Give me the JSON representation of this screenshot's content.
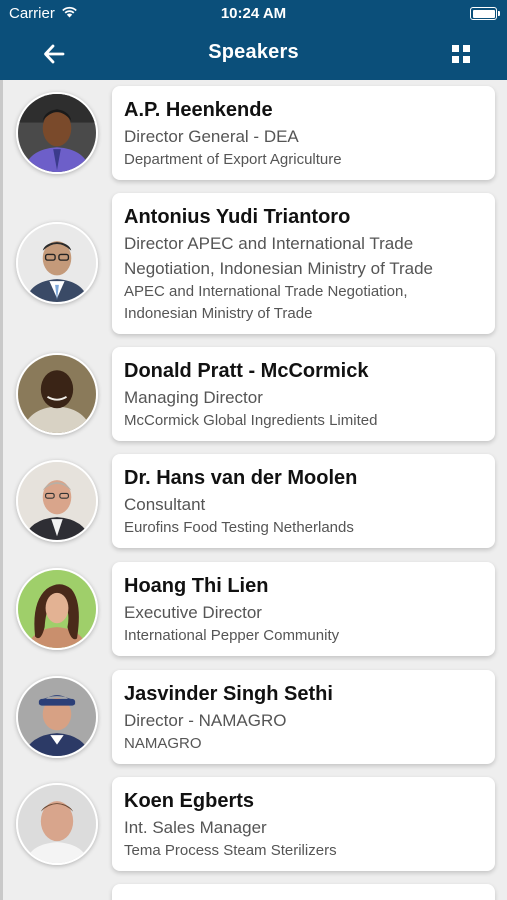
{
  "status_bar": {
    "carrier": "Carrier",
    "time": "10:24 AM"
  },
  "nav": {
    "title": "Speakers",
    "back_icon": "arrow-left-icon",
    "grid_icon": "grid-icon"
  },
  "colors": {
    "header": "#0b4f7a",
    "background": "#eeeeee",
    "card": "#ffffff"
  },
  "speakers": [
    {
      "name": "A.P. Heenkende",
      "title": "Director General - DEA",
      "org": "Department of Export Agriculture"
    },
    {
      "name": "Antonius Yudi Triantoro",
      "title": "Director APEC and International Trade Negotiation,  Indonesian Ministry of Trade",
      "org": "APEC and International Trade Negotiation, Indonesian Ministry of Trade"
    },
    {
      "name": "Donald Pratt - McCormick",
      "title": "Managing Director",
      "org": "McCormick Global Ingredients Limited"
    },
    {
      "name": "Dr. Hans van der Moolen",
      "title": "Consultant",
      "org": "Eurofins Food Testing Netherlands"
    },
    {
      "name": "Hoang Thi Lien",
      "title": "Executive Director",
      "org": "International Pepper Community"
    },
    {
      "name": "Jasvinder Singh Sethi",
      "title": "Director - NAMAGRO",
      "org": "NAMAGRO"
    },
    {
      "name": "Koen Egberts",
      "title": "Int. Sales Manager",
      "org": "Tema Process Steam Sterilizers"
    }
  ]
}
